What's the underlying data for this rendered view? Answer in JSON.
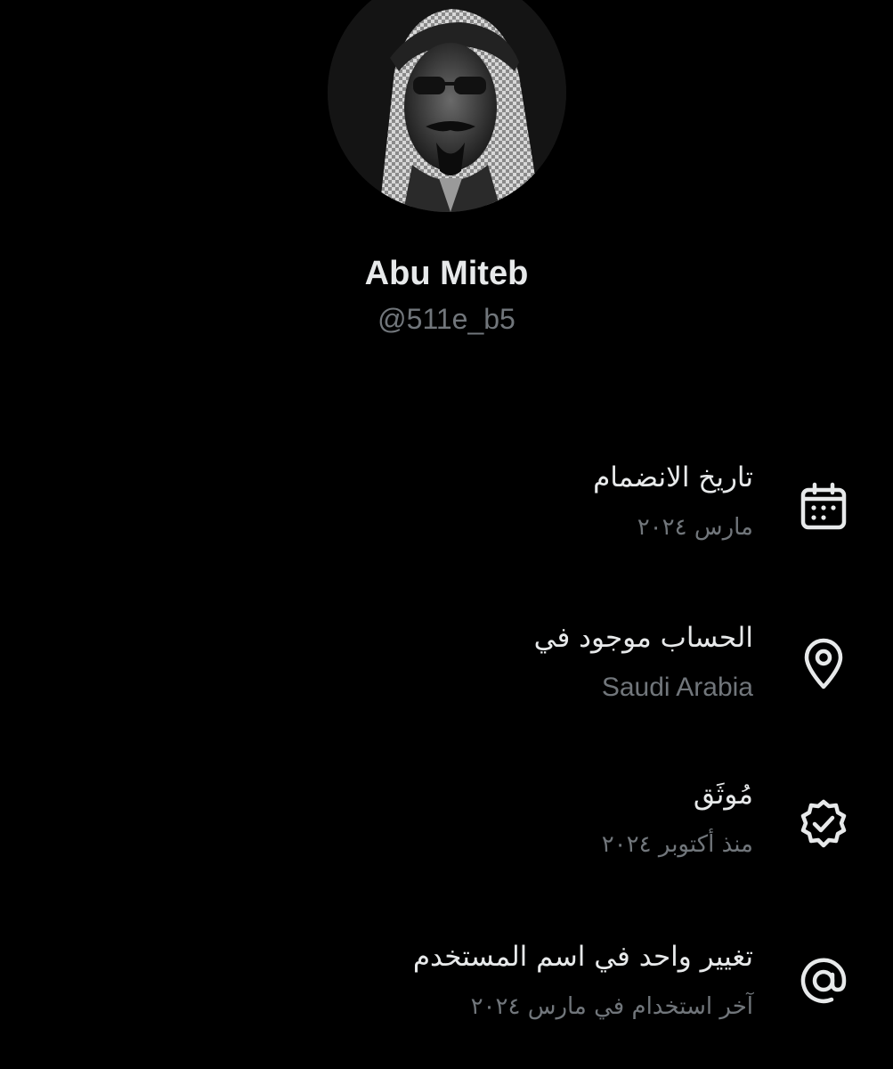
{
  "profile": {
    "display_name": "Abu Miteb",
    "handle": "@511e_b5"
  },
  "about": [
    {
      "icon": "calendar-icon",
      "label": "تاريخ الانضمام",
      "value": "مارس ٢٠٢٤"
    },
    {
      "icon": "location-pin-icon",
      "label": "الحساب موجود في",
      "value": "Saudi Arabia"
    },
    {
      "icon": "verified-badge-icon",
      "label": "مُوثَق",
      "value": "منذ أكتوبر ٢٠٢٤"
    },
    {
      "icon": "at-sign-icon",
      "label": "تغيير واحد في اسم المستخدم",
      "value": "آخر استخدام في مارس ٢٠٢٤"
    }
  ],
  "colors": {
    "background": "#000000",
    "primary_text": "#e7e9ea",
    "secondary_text": "#71767b"
  }
}
